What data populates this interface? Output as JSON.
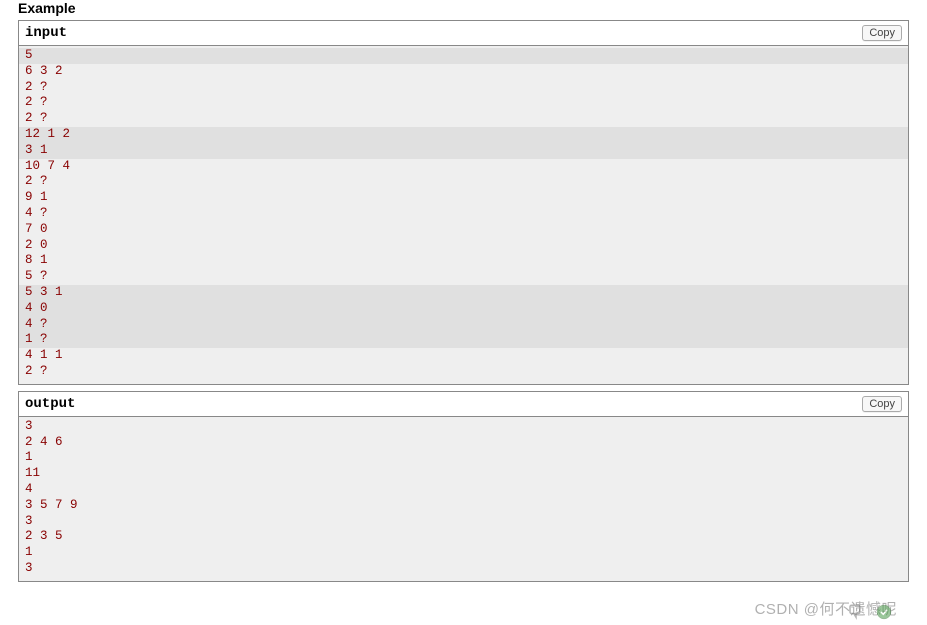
{
  "heading": "Example",
  "input_block": {
    "title": "input",
    "copy_label": "Copy",
    "lines": [
      {
        "text": "5",
        "hl": true
      },
      {
        "text": "6 3 2",
        "hl": false
      },
      {
        "text": "2 ?",
        "hl": false
      },
      {
        "text": "2 ?",
        "hl": false
      },
      {
        "text": "2 ?",
        "hl": false
      },
      {
        "text": "12 1 2",
        "hl": true
      },
      {
        "text": "3 1",
        "hl": true
      },
      {
        "text": "10 7 4",
        "hl": false
      },
      {
        "text": "2 ?",
        "hl": false
      },
      {
        "text": "9 1",
        "hl": false
      },
      {
        "text": "4 ?",
        "hl": false
      },
      {
        "text": "7 0",
        "hl": false
      },
      {
        "text": "2 0",
        "hl": false
      },
      {
        "text": "8 1",
        "hl": false
      },
      {
        "text": "5 ?",
        "hl": false
      },
      {
        "text": "5 3 1",
        "hl": true
      },
      {
        "text": "4 0",
        "hl": true
      },
      {
        "text": "4 ?",
        "hl": true
      },
      {
        "text": "1 ?",
        "hl": true
      },
      {
        "text": "4 1 1",
        "hl": false
      },
      {
        "text": "2 ?",
        "hl": false
      }
    ]
  },
  "output_block": {
    "title": "output",
    "copy_label": "Copy",
    "lines": [
      {
        "text": "3"
      },
      {
        "text": "2 4 6"
      },
      {
        "text": "1"
      },
      {
        "text": "11"
      },
      {
        "text": "4"
      },
      {
        "text": "3 5 7 9"
      },
      {
        "text": "3"
      },
      {
        "text": "2 3 5"
      },
      {
        "text": "1"
      },
      {
        "text": "3"
      }
    ]
  },
  "watermark": "CSDN @何不遗憾呢"
}
